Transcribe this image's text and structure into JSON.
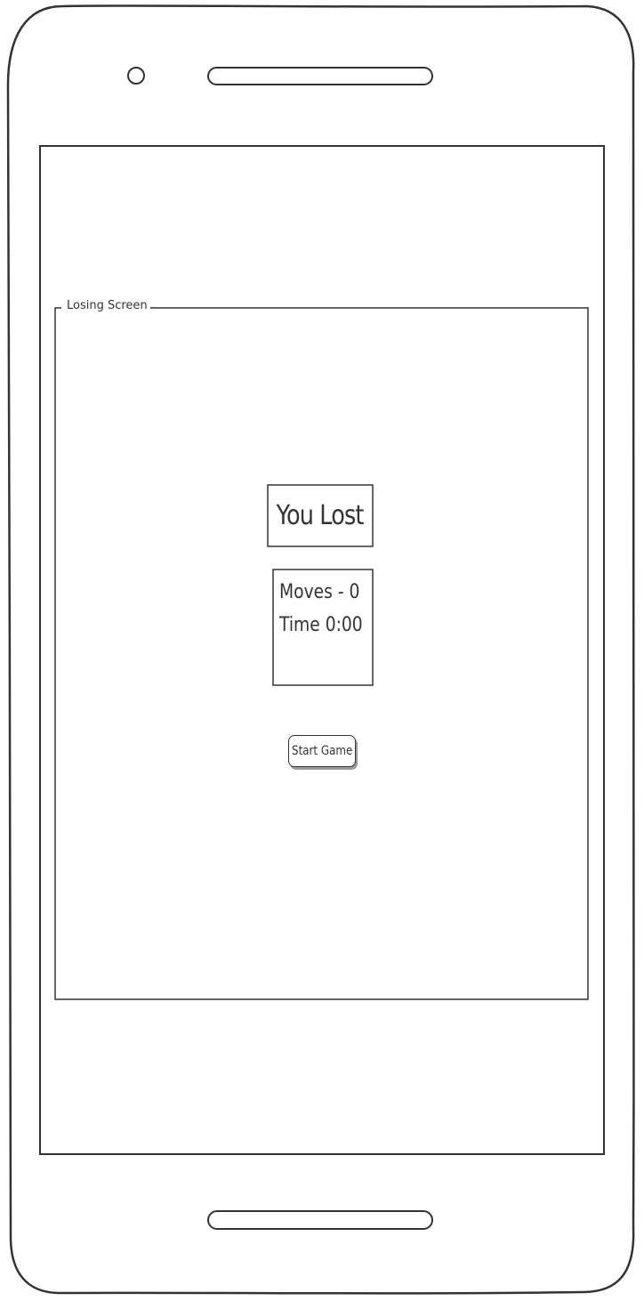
{
  "mockup": {
    "group_label": "Losing Screen"
  },
  "result": {
    "title": "You Lost",
    "moves_text": "Moves - 0",
    "time_text": "Time 0:00"
  },
  "actions": {
    "start_label": "Start Game"
  },
  "icons": {
    "camera": "camera-icon",
    "speaker": "speaker-icon",
    "home_bar": "home-bar-icon"
  },
  "colors": {
    "stroke": "#333333",
    "background": "#ffffff",
    "shadow": "#9a9a9a"
  }
}
